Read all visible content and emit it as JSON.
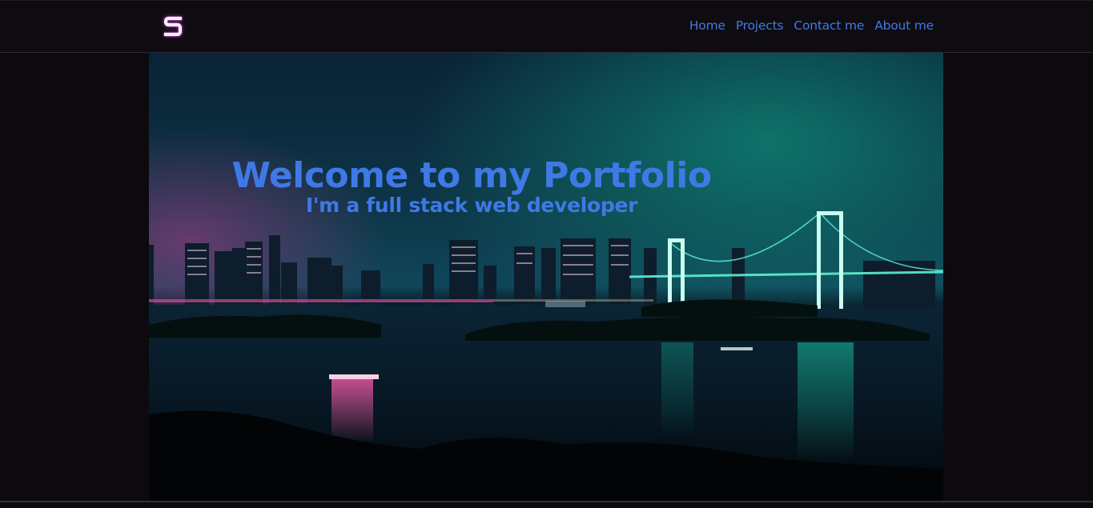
{
  "brand": {
    "logo_icon": "s-logo-icon",
    "logo_letter": "S",
    "accent_color": "#3f79e6"
  },
  "nav": {
    "items": [
      {
        "label": "Home"
      },
      {
        "label": "Projects"
      },
      {
        "label": "Contact me"
      },
      {
        "label": "About me"
      }
    ]
  },
  "hero": {
    "title": "Welcome to my Portfolio",
    "subtitle": "I'm a full stack web developer",
    "background_image": "night-city-bridge-skyline"
  }
}
